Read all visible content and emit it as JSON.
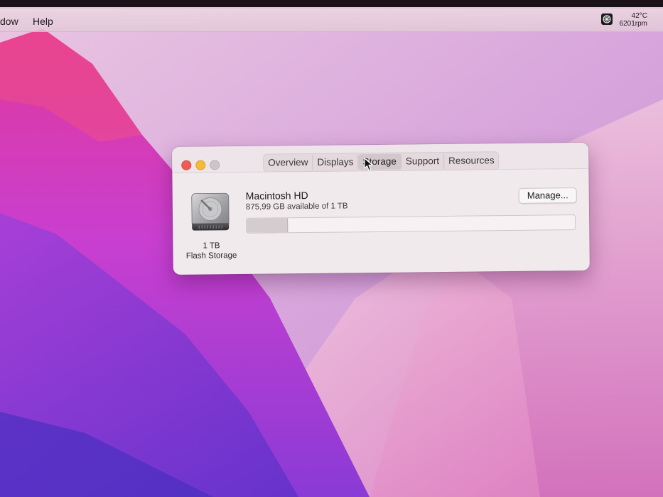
{
  "menubar": {
    "items": [
      "dow",
      "Help"
    ],
    "status": {
      "temperature": "42°C",
      "fan": "6201rpm"
    }
  },
  "window": {
    "tabs": [
      {
        "label": "Overview",
        "active": false
      },
      {
        "label": "Displays",
        "active": false
      },
      {
        "label": "Storage",
        "active": true
      },
      {
        "label": "Support",
        "active": false
      },
      {
        "label": "Resources",
        "active": false
      }
    ],
    "disk": {
      "size": "1 TB",
      "type": "Flash Storage"
    },
    "volume": {
      "name": "Macintosh HD",
      "available": "875,99 GB available of 1 TB",
      "used_fraction": 0.124
    },
    "manage_label": "Manage..."
  },
  "colors": {
    "close": "#ee5d55",
    "minimize": "#f4bb3a",
    "zoom": "#cdc6c9",
    "wallpaper_magenta": "#c93fd0",
    "wallpaper_pink": "#e7a2cf",
    "wallpaper_purple": "#6b36c6"
  },
  "icons": {
    "disk": "hard-drive-icon",
    "status": "fan-monitor-icon"
  }
}
